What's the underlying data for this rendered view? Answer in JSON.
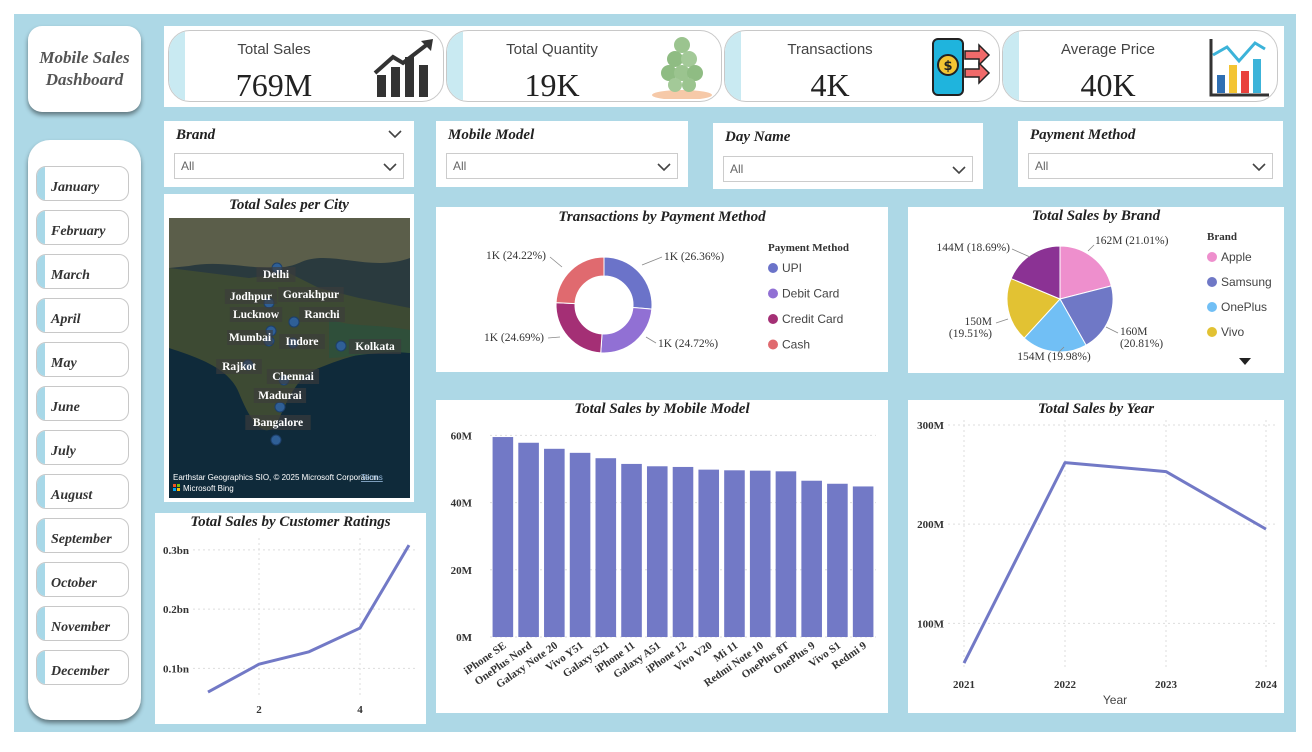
{
  "title": "Mobile Sales Dashboard",
  "kpis": [
    {
      "label": "Total Sales",
      "value": "769M",
      "icon": "growth-chart-icon"
    },
    {
      "label": "Total Quantity",
      "value": "19K",
      "icon": "coins-stack-icon"
    },
    {
      "label": "Transactions",
      "value": "4K",
      "icon": "mobile-payment-icon"
    },
    {
      "label": "Average Price",
      "value": "40K",
      "icon": "bar-chart-icon"
    }
  ],
  "months": [
    "January",
    "February",
    "March",
    "April",
    "May",
    "June",
    "July",
    "August",
    "September",
    "October",
    "November",
    "December"
  ],
  "slicers": {
    "brand": {
      "label": "Brand",
      "value": "All"
    },
    "model": {
      "label": "Mobile Model",
      "value": "All"
    },
    "day": {
      "label": "Day Name",
      "value": "All"
    },
    "payment": {
      "label": "Payment Method",
      "value": "All"
    }
  },
  "map": {
    "title": "Total Sales per City",
    "cities": [
      "Delhi",
      "Jodhpur",
      "Gorakhpur",
      "Lucknow",
      "Ranchi",
      "Mumbai",
      "Indore",
      "Kolkata",
      "Rajkot",
      "Chennai",
      "Madurai",
      "Bangalore"
    ],
    "attribution": "Earthstar Geographics SIO, © 2025 Microsoft Corporation",
    "terms": "Terms",
    "provider": "Microsoft Bing"
  },
  "colors": {
    "accent": "#7279c6",
    "background": "#add8e6"
  },
  "chart_data": [
    {
      "id": "payment",
      "type": "pie",
      "title": "Transactions by Payment Method",
      "legend_title": "Payment Method",
      "legend_position": "right",
      "slices": [
        {
          "name": "UPI",
          "value": 26.36,
          "label": "1K (26.36%)",
          "color": "#6b73c9"
        },
        {
          "name": "Debit Card",
          "value": 24.72,
          "label": "1K (24.72%)",
          "color": "#9170d4"
        },
        {
          "name": "Credit Card",
          "value": 24.69,
          "label": "1K (24.69%)",
          "color": "#a42f75"
        },
        {
          "name": "Cash",
          "value": 24.22,
          "label": "1K (24.22%)",
          "color": "#e06a6f"
        }
      ]
    },
    {
      "id": "brand",
      "type": "pie",
      "title": "Total Sales by Brand",
      "legend_title": "Brand",
      "legend_position": "right",
      "slices": [
        {
          "name": "Apple",
          "value": 21.01,
          "label": "162M (21.01%)",
          "color": "#ee8fcd"
        },
        {
          "name": "Samsung",
          "value": 20.81,
          "label": "160M (20.81%)",
          "color": "#6f78c6"
        },
        {
          "name": "OnePlus",
          "value": 19.98,
          "label": "154M (19.98%)",
          "color": "#71bff5"
        },
        {
          "name": "Vivo",
          "value": 19.51,
          "label": "150M (19.51%)",
          "color": "#e2c233"
        },
        {
          "name": "",
          "value": 18.69,
          "label": "144M (18.69%)",
          "color": "#8b3294"
        }
      ]
    },
    {
      "id": "model",
      "type": "bar",
      "title": "Total Sales by Mobile Model",
      "categories": [
        "iPhone SE",
        "OnePlus Nord",
        "Galaxy Note 20",
        "Vivo Y51",
        "Galaxy S21",
        "iPhone 11",
        "Galaxy A51",
        "iPhone 12",
        "Vivo V20",
        "Mi 11",
        "Redmi Note 10",
        "OnePlus 8T",
        "OnePlus 9",
        "Vivo S1",
        "Redmi 9"
      ],
      "values": [
        59.5,
        57.8,
        56.0,
        54.8,
        53.2,
        51.5,
        50.8,
        50.6,
        49.8,
        49.6,
        49.5,
        49.3,
        46.5,
        45.6,
        44.8
      ],
      "yticks": [
        "0M",
        "20M",
        "40M",
        "60M"
      ],
      "ylim": [
        0,
        61
      ],
      "color": "#7279c6"
    },
    {
      "id": "year",
      "type": "line",
      "title": "Total Sales by Year",
      "xlabel": "Year",
      "x": [
        "2021",
        "2022",
        "2023",
        "2024"
      ],
      "values": [
        60,
        262,
        253,
        195
      ],
      "yticks": [
        "100M",
        "200M",
        "300M"
      ],
      "ylim": [
        55,
        305
      ],
      "color": "#7279c6"
    },
    {
      "id": "ratings",
      "type": "line",
      "title": "Total Sales by Customer Ratings",
      "x": [
        1,
        2,
        3,
        4,
        5
      ],
      "xticks": [
        "2",
        "4"
      ],
      "values": [
        0.06,
        0.107,
        0.128,
        0.168,
        0.308
      ],
      "yticks": [
        "0.1bn",
        "0.2bn",
        "0.3bn"
      ],
      "ylim": [
        0.05,
        0.32
      ],
      "color": "#7279c6"
    }
  ]
}
